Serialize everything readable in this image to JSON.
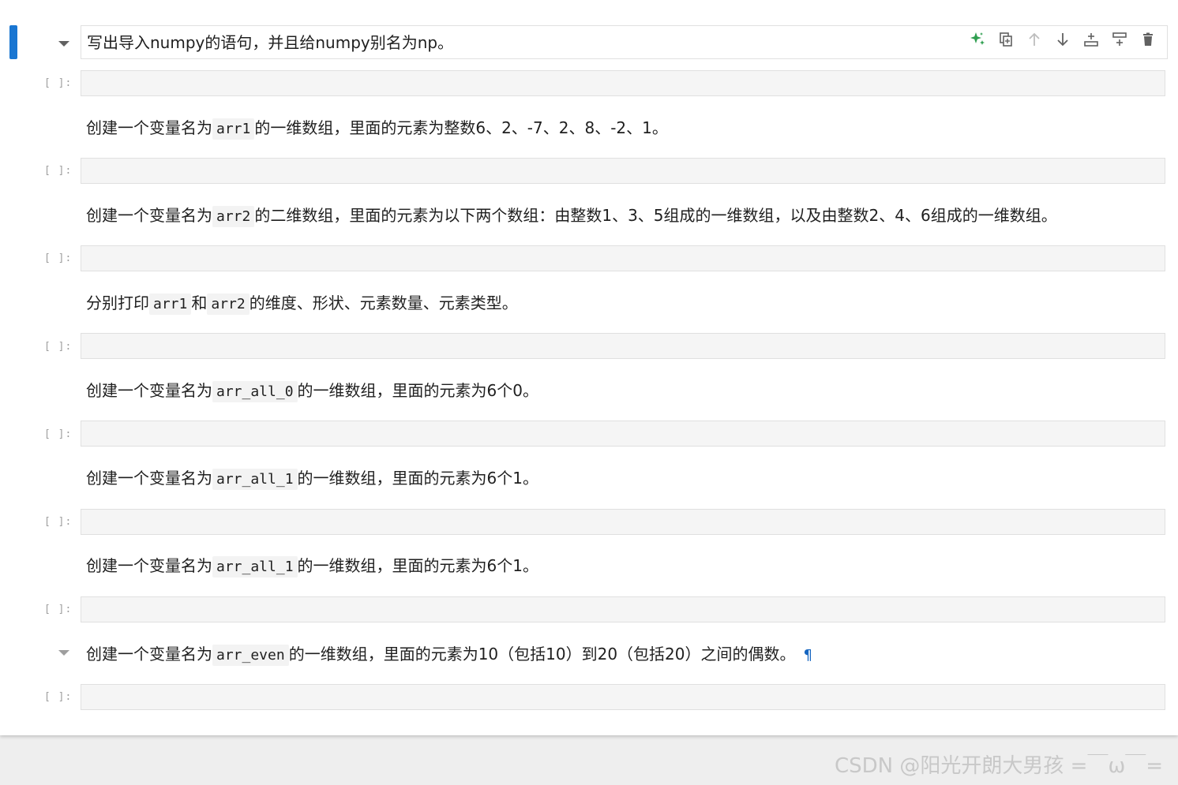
{
  "cells": [
    {
      "type": "markdown",
      "segments": [
        {
          "text": "写出导入numpy的语句，并且给numpy别名为np。"
        }
      ]
    },
    {
      "type": "code",
      "prompt": "[ ]:"
    },
    {
      "type": "markdown",
      "segments": [
        {
          "text": "创建一个变量名为"
        },
        {
          "code": "arr1"
        },
        {
          "text": "的一维数组，里面的元素为整数6、2、-7、2、8、-2、1。"
        }
      ]
    },
    {
      "type": "code",
      "prompt": "[ ]:"
    },
    {
      "type": "markdown",
      "segments": [
        {
          "text": "创建一个变量名为"
        },
        {
          "code": "arr2"
        },
        {
          "text": "的二维数组，里面的元素为以下两个数组：由整数1、3、5组成的一维数组，以及由整数2、4、6组成的一维数组。"
        }
      ]
    },
    {
      "type": "code",
      "prompt": "[ ]:"
    },
    {
      "type": "markdown",
      "segments": [
        {
          "text": "分别打印"
        },
        {
          "code": "arr1"
        },
        {
          "text": "和"
        },
        {
          "code": "arr2"
        },
        {
          "text": "的维度、形状、元素数量、元素类型。"
        }
      ]
    },
    {
      "type": "code",
      "prompt": "[ ]:"
    },
    {
      "type": "markdown",
      "segments": [
        {
          "text": "创建一个变量名为"
        },
        {
          "code": "arr_all_0"
        },
        {
          "text": "的一维数组，里面的元素为6个0。"
        }
      ]
    },
    {
      "type": "code",
      "prompt": "[ ]:"
    },
    {
      "type": "markdown",
      "segments": [
        {
          "text": "创建一个变量名为"
        },
        {
          "code": "arr_all_1"
        },
        {
          "text": "的一维数组，里面的元素为6个1。"
        }
      ]
    },
    {
      "type": "code",
      "prompt": "[ ]:"
    },
    {
      "type": "markdown",
      "segments": [
        {
          "text": "创建一个变量名为"
        },
        {
          "code": "arr_all_1"
        },
        {
          "text": "的一维数组，里面的元素为6个1。"
        }
      ]
    },
    {
      "type": "code",
      "prompt": "[ ]:"
    },
    {
      "type": "markdown",
      "segments": [
        {
          "text": "创建一个变量名为"
        },
        {
          "code": "arr_even"
        },
        {
          "text": "的一维数组，里面的元素为10（包括10）到20（包括20）之间的偶数。"
        }
      ],
      "pilcrow": "¶"
    },
    {
      "type": "code",
      "prompt": "[ ]:"
    }
  ],
  "toolbar": [
    {
      "name": "ai-assist-icon",
      "color": "#2e9e4f"
    },
    {
      "name": "duplicate-icon",
      "color": "#616161"
    },
    {
      "name": "move-up-icon",
      "color": "#bdbdbd"
    },
    {
      "name": "move-down-icon",
      "color": "#616161"
    },
    {
      "name": "insert-above-icon",
      "color": "#616161"
    },
    {
      "name": "insert-below-icon",
      "color": "#616161"
    },
    {
      "name": "delete-icon",
      "color": "#616161"
    }
  ],
  "watermark": "CSDN @阳光开朗大男孩 =￣ω￣="
}
